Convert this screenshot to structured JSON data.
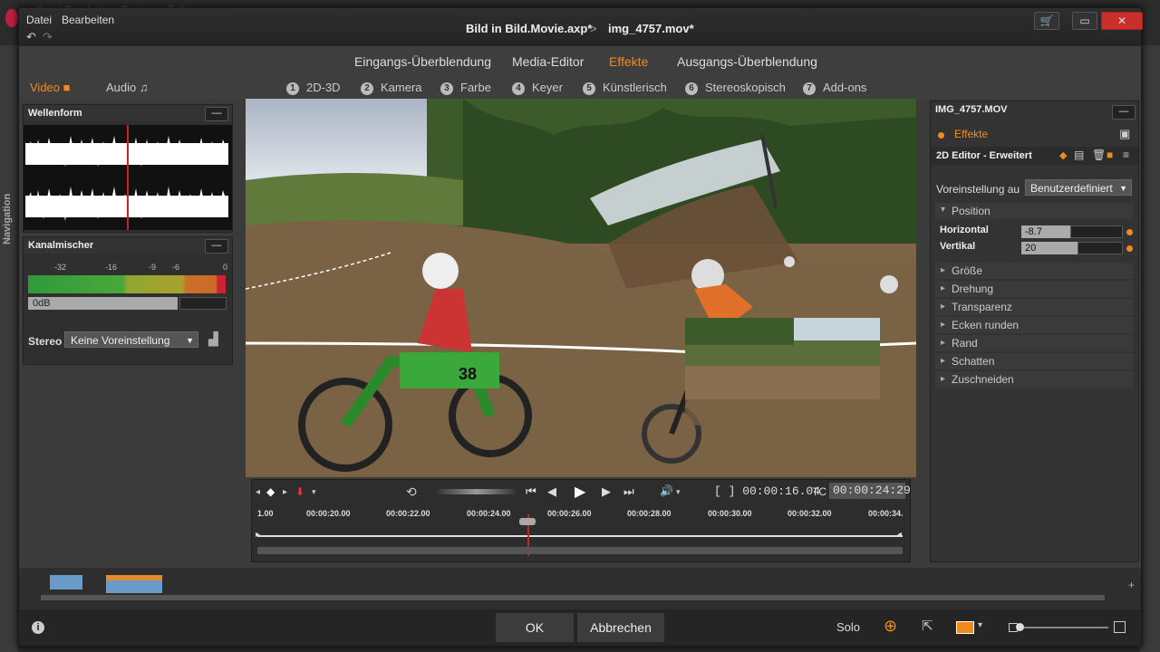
{
  "bg": {
    "menu": "Datei   Bearbeiten   Optionen   E-Store",
    "navigation_label": "Navigation"
  },
  "titlebar": {
    "menu": [
      "Datei",
      "Bearbeiten"
    ],
    "project": "Bild in Bild.Movie.axp*",
    "separator": ">",
    "clip": "img_4757.mov*"
  },
  "tabs": [
    {
      "label": "Eingangs-Überblendung",
      "active": false
    },
    {
      "label": "Media-Editor",
      "active": false
    },
    {
      "label": "Effekte",
      "active": true
    },
    {
      "label": "Ausgangs-Überblendung",
      "active": false
    }
  ],
  "media": {
    "video": "Video",
    "audio": "Audio"
  },
  "categories": [
    {
      "num": "1",
      "label": "2D-3D"
    },
    {
      "num": "2",
      "label": "Kamera"
    },
    {
      "num": "3",
      "label": "Farbe"
    },
    {
      "num": "4",
      "label": "Keyer"
    },
    {
      "num": "5",
      "label": "Künstlerisch"
    },
    {
      "num": "6",
      "label": "Stereoskopisch"
    },
    {
      "num": "7",
      "label": "Add-ons"
    }
  ],
  "waveform": {
    "title": "Wellenform",
    "minimize": "—"
  },
  "mixer": {
    "title": "Kanalmischer",
    "minimize": "—",
    "scale": [
      "-32",
      "-16",
      "-9",
      "-6",
      "0"
    ],
    "db_value": "0dB",
    "stereo_label": "Stereo",
    "preset": "Keine Voreinstellung"
  },
  "transport": {
    "position": "[ ] 00:00:16.04",
    "tc_label": "TC",
    "timecode": "00:00:24:29",
    "ruler": [
      "1.00",
      "00:00:20.00",
      "00:00:22.00",
      "00:00:24.00",
      "00:00:26.00",
      "00:00:28.00",
      "00:00:30.00",
      "00:00:32.00",
      "00:00:34."
    ]
  },
  "right_panel": {
    "clip_title": "IMG_4757.MOV",
    "minimize": "—",
    "effects_label": "Effekte",
    "editor_title": "2D Editor - Erweitert",
    "preset_label": "Voreinstellung au",
    "preset_value": "Benutzerdefiniert",
    "position_label": "Position",
    "horizontal_label": "Horizontal",
    "horizontal_value": "-8.7",
    "vertical_label": "Vertikal",
    "vertical_value": "20",
    "props": [
      "Größe",
      "Drehung",
      "Transparenz",
      "Ecken runden",
      "Rand",
      "Schatten",
      "Zuschneiden"
    ]
  },
  "bottom": {
    "info_icon": "i",
    "ok": "OK",
    "cancel": "Abbrechen",
    "solo": "Solo"
  },
  "colors": {
    "accent": "#f08a1c",
    "close": "#c9302c"
  }
}
